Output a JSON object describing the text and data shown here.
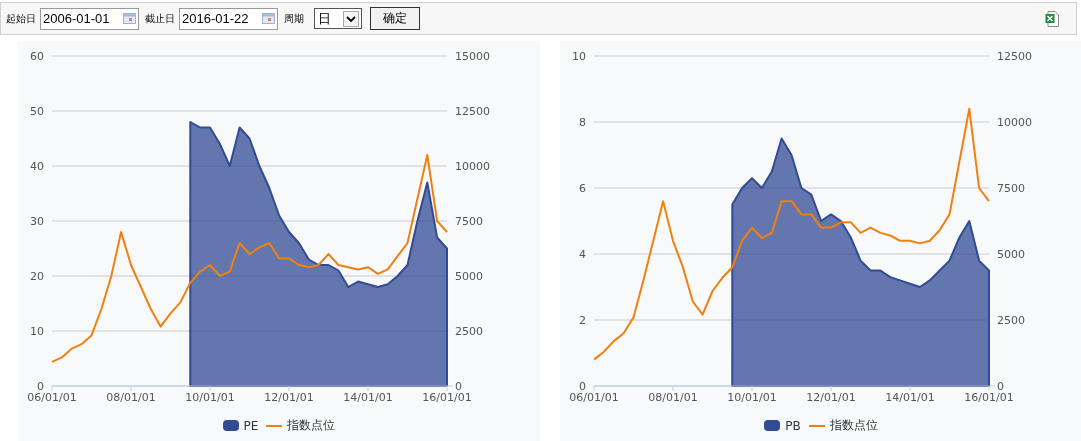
{
  "toolbar": {
    "start_label": "起始日",
    "start_date": "2006-01-01",
    "end_label": "截止日",
    "end_date": "2016-01-22",
    "period_label": "周期",
    "period": "日",
    "confirm": "确定"
  },
  "charts": [
    {
      "chart_data": {
        "type": "area",
        "categories": [
          "06/01/01",
          null,
          null,
          null,
          null,
          null,
          null,
          null,
          "08/01/01",
          null,
          null,
          null,
          null,
          null,
          null,
          null,
          "10/01/01",
          null,
          null,
          null,
          null,
          null,
          null,
          null,
          "12/01/01",
          null,
          null,
          null,
          null,
          null,
          null,
          null,
          "14/01/01",
          null,
          null,
          null,
          null,
          null,
          null,
          null,
          "16/01/01"
        ],
        "grid": true,
        "ylim": [
          0,
          60
        ],
        "yticks": [
          0,
          10,
          20,
          30,
          40,
          50,
          60
        ],
        "y2lim": [
          0,
          15000
        ],
        "y2ticks": [
          0,
          2500,
          5000,
          7500,
          10000,
          12500,
          15000
        ],
        "series": [
          {
            "name": "PE",
            "type": "area",
            "color": "#334a94",
            "values": [
              null,
              null,
              null,
              null,
              null,
              null,
              null,
              null,
              null,
              null,
              null,
              null,
              null,
              null,
              48,
              47,
              47,
              44,
              40,
              47,
              45,
              40,
              36,
              31,
              28,
              26,
              23,
              22,
              22,
              21,
              18,
              19,
              18.5,
              18,
              18.5,
              20,
              22,
              30,
              37,
              27,
              25
            ]
          },
          {
            "name": "指数点位",
            "type": "line",
            "axis": "y2",
            "color": "#f08010",
            "values": [
              1100,
              1300,
              1700,
              1900,
              2300,
              3500,
              5000,
              7000,
              5500,
              4500,
              3500,
              2700,
              3300,
              3800,
              4700,
              5200,
              5500,
              5000,
              5200,
              6500,
              6000,
              6300,
              6500,
              5800,
              5800,
              5500,
              5400,
              5500,
              6000,
              5500,
              5400,
              5300,
              5400,
              5100,
              5300,
              5900,
              6500,
              8500,
              10500,
              7500,
              7000
            ]
          }
        ]
      }
    },
    {
      "chart_data": {
        "type": "area",
        "categories": [
          "06/01/01",
          null,
          null,
          null,
          null,
          null,
          null,
          null,
          "08/01/01",
          null,
          null,
          null,
          null,
          null,
          null,
          null,
          "10/01/01",
          null,
          null,
          null,
          null,
          null,
          null,
          null,
          "12/01/01",
          null,
          null,
          null,
          null,
          null,
          null,
          null,
          "14/01/01",
          null,
          null,
          null,
          null,
          null,
          null,
          null,
          "16/01/01"
        ],
        "grid": true,
        "ylim": [
          0,
          10
        ],
        "yticks": [
          0,
          2,
          4,
          6,
          8,
          10
        ],
        "y2lim": [
          0,
          12500
        ],
        "y2ticks": [
          0,
          2500,
          5000,
          7500,
          10000,
          12500
        ],
        "series": [
          {
            "name": "PB",
            "type": "area",
            "color": "#334a94",
            "values": [
              null,
              null,
              null,
              null,
              null,
              null,
              null,
              null,
              null,
              null,
              null,
              null,
              null,
              null,
              5.5,
              6,
              6.3,
              6,
              6.5,
              7.5,
              7,
              6,
              5.8,
              5,
              5.2,
              5,
              4.5,
              3.8,
              3.5,
              3.5,
              3.3,
              3.2,
              3.1,
              3,
              3.2,
              3.5,
              3.8,
              4.5,
              5,
              3.8,
              3.5
            ]
          },
          {
            "name": "指数点位",
            "type": "line",
            "axis": "y2",
            "color": "#f08010",
            "values": [
              1000,
              1300,
              1700,
              2000,
              2600,
              4000,
              5500,
              7000,
              5500,
              4500,
              3200,
              2700,
              3600,
              4100,
              4500,
              5500,
              6000,
              5600,
              5800,
              7000,
              7000,
              6500,
              6500,
              6000,
              6000,
              6200,
              6200,
              5800,
              6000,
              5800,
              5700,
              5500,
              5500,
              5400,
              5500,
              5900,
              6500,
              8500,
              10500,
              7500,
              7000
            ]
          }
        ]
      }
    }
  ]
}
